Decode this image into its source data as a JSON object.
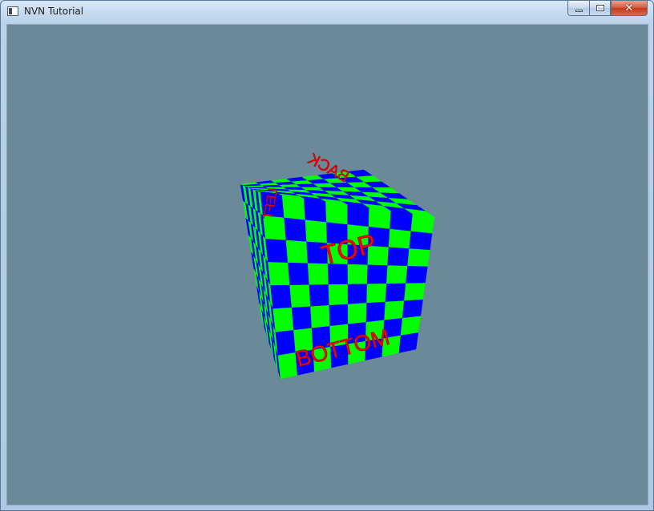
{
  "window": {
    "title": "NVN Tutorial",
    "icon": "app-window-icon",
    "controls": {
      "minimize_icon": "minimize-icon",
      "maximize_icon": "maximize-icon",
      "close_glyph": "✕"
    }
  },
  "scene": {
    "clear_color": "#6a8a9a",
    "checker_colors": [
      "#0000ff",
      "#00ff00"
    ],
    "label_color": "#ff0000",
    "face_labels": {
      "top": "TOP",
      "bottom": "BOTTOM",
      "back": "BACK",
      "side": "LEFT"
    }
  }
}
